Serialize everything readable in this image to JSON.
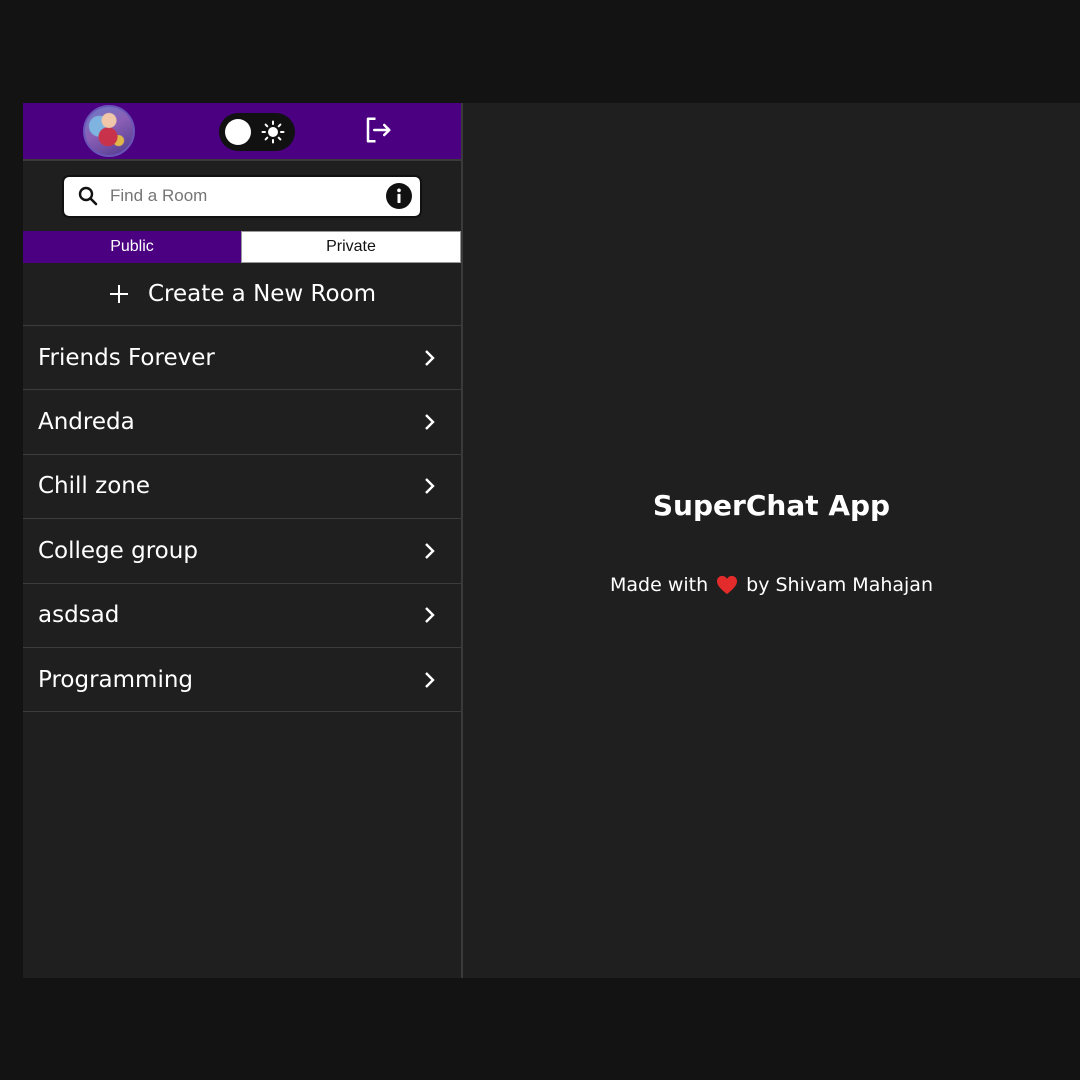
{
  "header": {
    "avatar_alt": "user avatar",
    "theme_toggle_icon": "sun-icon",
    "logout_icon": "logout-icon"
  },
  "search": {
    "placeholder": "Find a Room",
    "value": ""
  },
  "tabs": [
    {
      "label": "Public",
      "active": true
    },
    {
      "label": "Private",
      "active": false
    }
  ],
  "create_room": {
    "label": "Create a New Room"
  },
  "rooms": [
    {
      "name": "Friends Forever"
    },
    {
      "name": "Andreda"
    },
    {
      "name": "Chill zone"
    },
    {
      "name": "College group"
    },
    {
      "name": "asdsad"
    },
    {
      "name": "Programming"
    }
  ],
  "main": {
    "title": "SuperChat App",
    "credit_prefix": "Made with",
    "credit_suffix": "by Shivam Mahajan"
  },
  "colors": {
    "accent": "#4b0082",
    "background": "#1f1f1f",
    "page_background": "#131313",
    "heart": "#e32b2b"
  }
}
